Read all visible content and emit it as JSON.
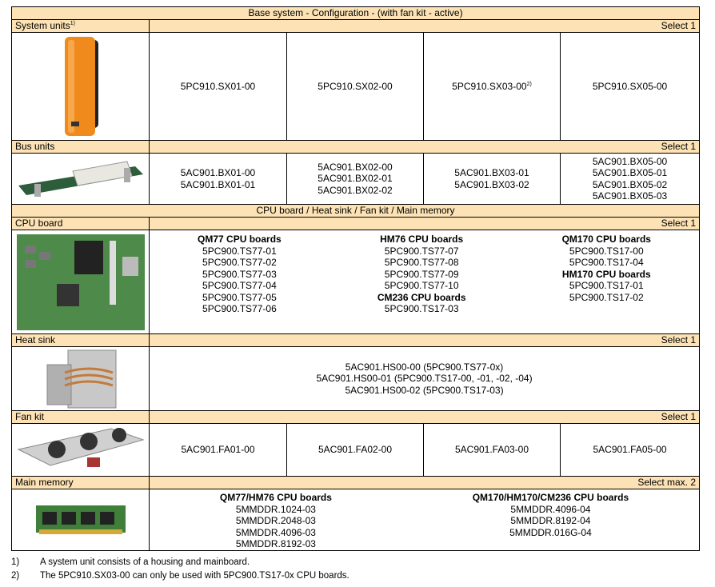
{
  "title": "Base system - Configuration - (with fan kit - active)",
  "section2_title": "CPU board / Heat sink / Fan kit / Main memory",
  "system_units": {
    "label": "System units",
    "label_sup": "1)",
    "select": "Select 1",
    "items": [
      "5PC910.SX01-00",
      "5PC910.SX02-00",
      "5PC910.SX03-00",
      "5PC910.SX05-00"
    ],
    "item3_sup": "2)"
  },
  "bus_units": {
    "label": "Bus units",
    "select": "Select 1",
    "cells": [
      [
        "5AC901.BX01-00",
        "5AC901.BX01-01"
      ],
      [
        "5AC901.BX02-00",
        "5AC901.BX02-01",
        "5AC901.BX02-02"
      ],
      [
        "5AC901.BX03-01",
        "5AC901.BX03-02"
      ],
      [
        "5AC901.BX05-00",
        "5AC901.BX05-01",
        "5AC901.BX05-02",
        "5AC901.BX05-03"
      ]
    ]
  },
  "cpu_board": {
    "label": "CPU board",
    "select": "Select 1",
    "col1": {
      "heading": "QM77 CPU boards",
      "items": [
        "5PC900.TS77-01",
        "5PC900.TS77-02",
        "5PC900.TS77-03",
        "5PC900.TS77-04",
        "5PC900.TS77-05",
        "5PC900.TS77-06"
      ]
    },
    "col2": {
      "heading": "HM76 CPU boards",
      "items": [
        "5PC900.TS77-07",
        "5PC900.TS77-08",
        "5PC900.TS77-09",
        "5PC900.TS77-10"
      ],
      "heading2": "CM236 CPU boards",
      "items2": [
        "5PC900.TS17-03"
      ]
    },
    "col3": {
      "heading": "QM170 CPU boards",
      "items": [
        "5PC900.TS17-00",
        "5PC900.TS17-04"
      ],
      "heading2": "HM170 CPU boards",
      "items2": [
        "5PC900.TS17-01",
        "5PC900.TS17-02"
      ]
    }
  },
  "heat_sink": {
    "label": "Heat sink",
    "select": "Select 1",
    "items": [
      "5AC901.HS00-00 (5PC900.TS77-0x)",
      "5AC901.HS00-01 (5PC900.TS17-00, -01, -02, -04)",
      "5AC901.HS00-02 (5PC900.TS17-03)"
    ]
  },
  "fan_kit": {
    "label": "Fan kit",
    "select": "Select 1",
    "items": [
      "5AC901.FA01-00",
      "5AC901.FA02-00",
      "5AC901.FA03-00",
      "5AC901.FA05-00"
    ]
  },
  "main_memory": {
    "label": "Main memory",
    "select": "Select max. 2",
    "col1": {
      "heading": "QM77/HM76 CPU boards",
      "items": [
        "5MMDDR.1024-03",
        "5MMDDR.2048-03",
        "5MMDDR.4096-03",
        "5MMDDR.8192-03"
      ]
    },
    "col2": {
      "heading": "QM170/HM170/CM236 CPU boards",
      "items": [
        "5MMDDR.4096-04",
        "5MMDDR.8192-04",
        "5MMDDR.016G-04"
      ]
    }
  },
  "footnotes": [
    {
      "num": "1)",
      "text": "A system unit consists of a housing and mainboard."
    },
    {
      "num": "2)",
      "text": "The 5PC910.SX03-00 can only be used with 5PC900.TS17-0x CPU boards."
    }
  ],
  "colors": {
    "band": "#fce2b4",
    "accent_orange": "#f08a1c"
  }
}
